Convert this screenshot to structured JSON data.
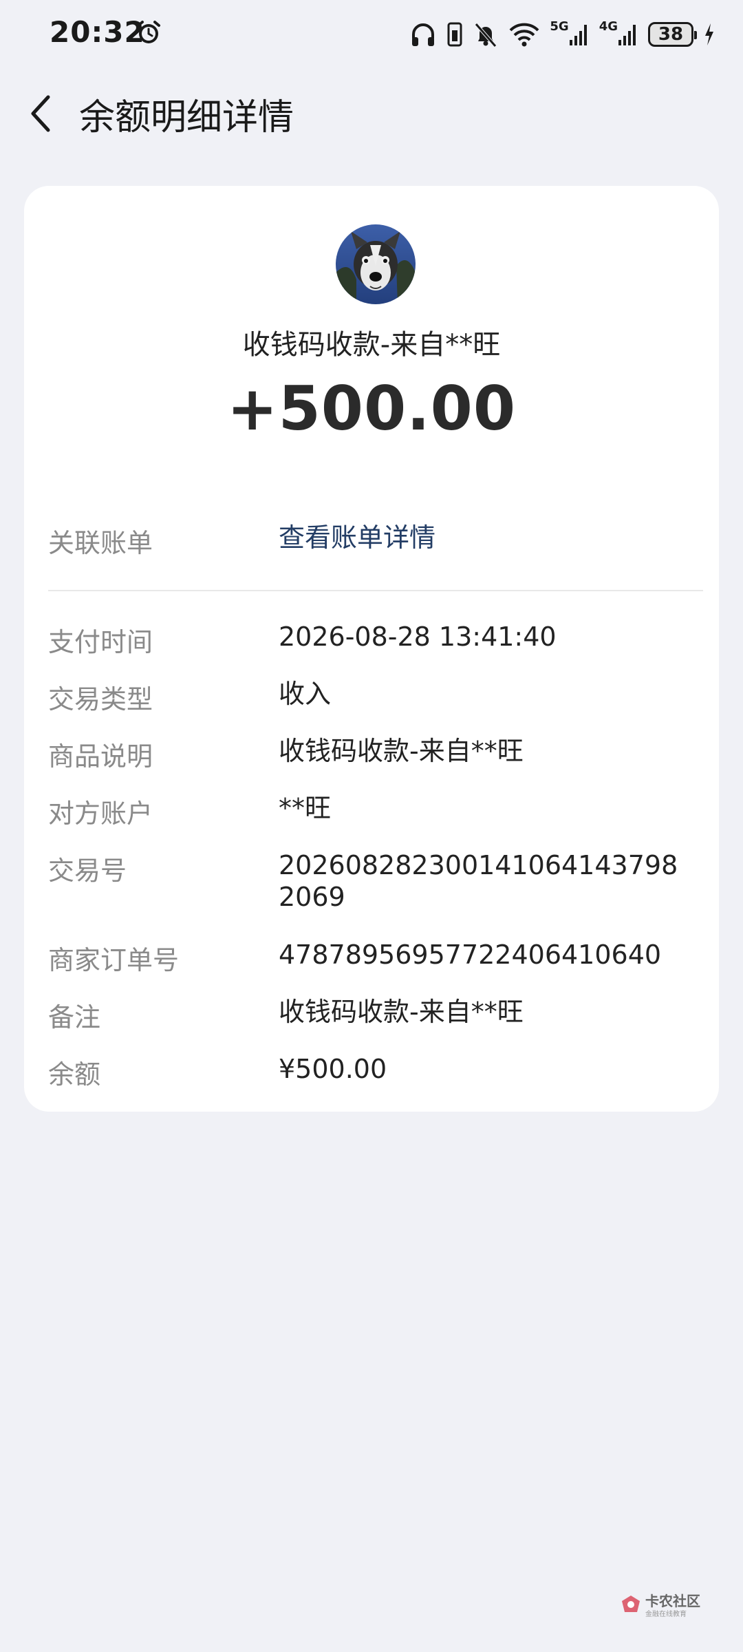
{
  "status_bar": {
    "time": "20:32",
    "battery": "38",
    "network_1": "5G",
    "network_2": "4G"
  },
  "header": {
    "title": "余额明细详情"
  },
  "transaction": {
    "payee_title": "收钱码收款-来自**旺",
    "amount": "+500.00"
  },
  "linked_bill": {
    "label": "关联账单",
    "value": "查看账单详情"
  },
  "details": [
    {
      "label": "支付时间",
      "value": "2026-08-28 13:41:40"
    },
    {
      "label": "交易类型",
      "value": "收入"
    },
    {
      "label": "商品说明",
      "value": "收钱码收款-来自**旺"
    },
    {
      "label": "对方账户",
      "value": "**旺"
    },
    {
      "label": "交易号",
      "value": "2026082823001410641437982069"
    },
    {
      "label": "商家订单号",
      "value": "4787895695772240641064​0"
    },
    {
      "label": "备注",
      "value": "收钱码收款-来自**旺"
    },
    {
      "label": "余额",
      "value": "¥500.00"
    }
  ],
  "watermark": {
    "text": "卡农社区",
    "subtext": "金融在线教育"
  },
  "colors": {
    "background": "#f0f1f6",
    "card": "#ffffff",
    "link": "#233d65",
    "label": "#8a8a8a"
  }
}
